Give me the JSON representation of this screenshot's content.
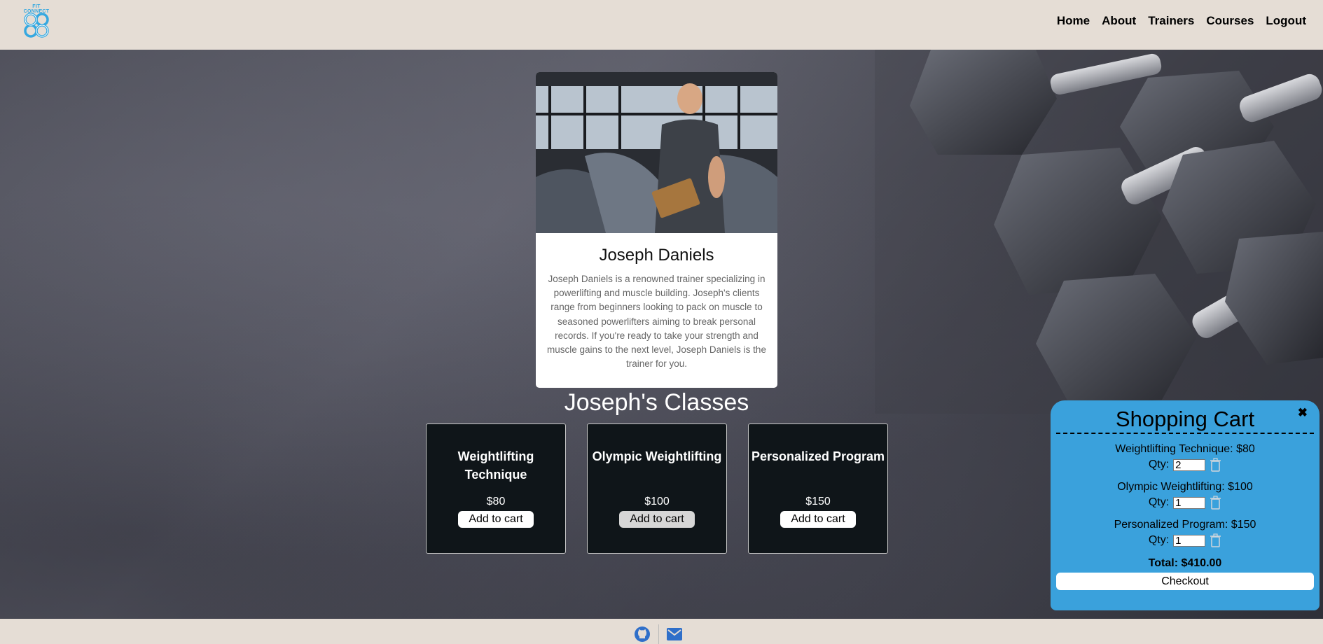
{
  "nav": {
    "logo_text": "FIT CONNECT",
    "links": [
      "Home",
      "About",
      "Trainers",
      "Courses",
      "Logout"
    ]
  },
  "trainer": {
    "name": "Joseph Daniels",
    "bio": "Joseph Daniels is a renowned trainer specializing in powerlifting and muscle building. Joseph's clients range from beginners looking to pack on muscle to seasoned powerlifters aiming to break personal records. If you're ready to take your strength and muscle gains to the next level, Joseph Daniels is the trainer for you."
  },
  "classes": {
    "title": "Joseph's Classes",
    "items": [
      {
        "name": "Weightlifting Technique",
        "price": "$80",
        "button": "Add to cart"
      },
      {
        "name": "Olympic Weightlifting",
        "price": "$100",
        "button": "Add to cart"
      },
      {
        "name": "Personalized Program",
        "price": "$150",
        "button": "Add to cart"
      }
    ]
  },
  "cart": {
    "title": "Shopping Cart",
    "close": "✖",
    "qty_label": "Qty:",
    "items": [
      {
        "label": "Weightlifting Technique: $80",
        "qty": "2"
      },
      {
        "label": "Olympic Weightlifting: $100",
        "qty": "1"
      },
      {
        "label": "Personalized Program: $150",
        "qty": "1"
      }
    ],
    "total": "Total: $410.00",
    "checkout": "Checkout"
  },
  "footer": {
    "icons": [
      "github-icon",
      "mail-icon"
    ]
  },
  "colors": {
    "accent": "#3aa1dc",
    "header_bg": "#e5ddd5",
    "class_card_bg": "#0f1519",
    "footer_icon": "#2f6fc9"
  }
}
